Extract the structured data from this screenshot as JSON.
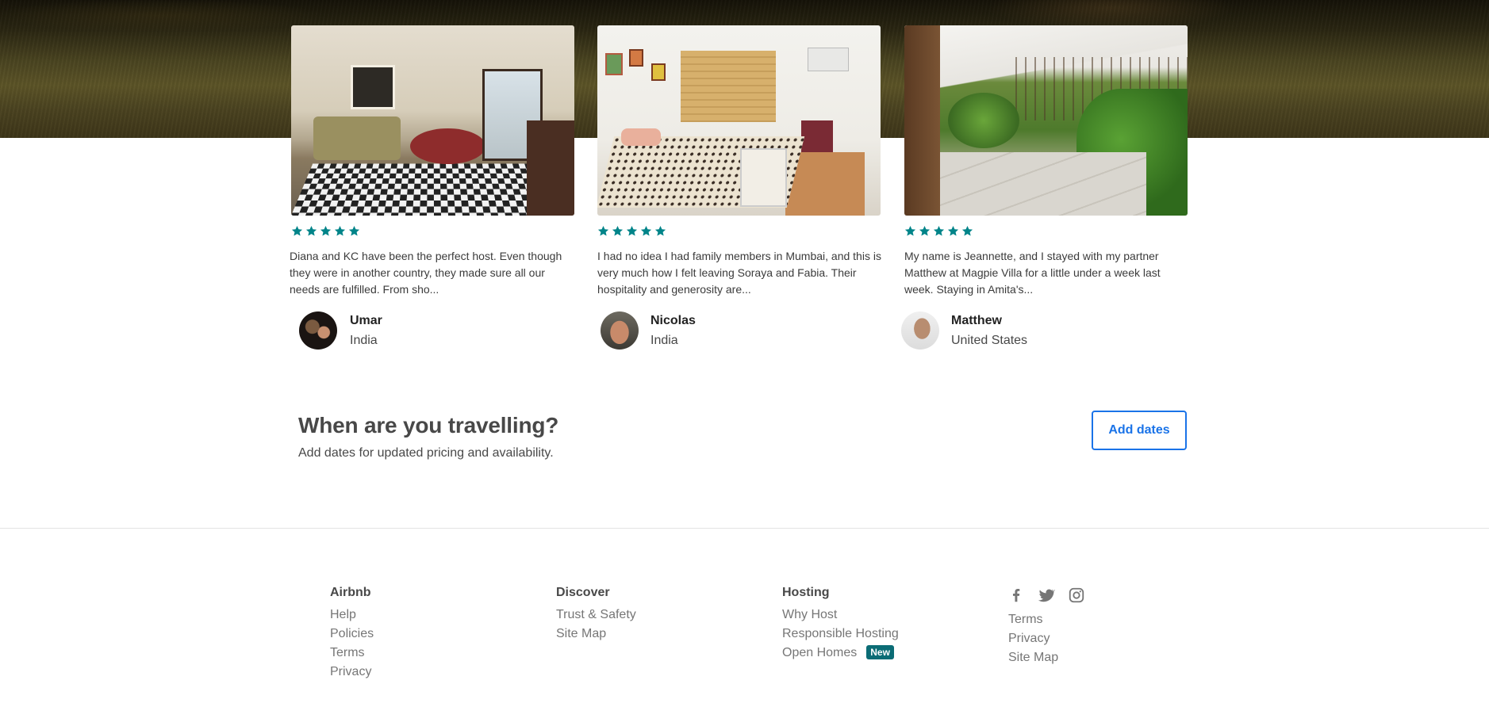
{
  "colors": {
    "star": "#008489",
    "link": "#1a73e8",
    "badge": "#0b6c75"
  },
  "reviews": [
    {
      "rating": 5,
      "text": "Diana and KC have been the perfect host. Even though they were in another country, they made sure all our needs are fulfilled. From sho...",
      "name": "Umar",
      "country": "India"
    },
    {
      "rating": 5,
      "text": "I had no idea I had family members in Mumbai, and this is very much how I felt leaving Soraya and Fabia. Their hospitality and generosity are...",
      "name": "Nicolas",
      "country": "India"
    },
    {
      "rating": 5,
      "text": "My name is Jeannette, and I stayed with my partner Matthew at Magpie Villa for a little under a week last week. Staying in Amita's...",
      "name": "Matthew",
      "country": "United States"
    }
  ],
  "travel": {
    "title": "When are you travelling?",
    "subtitle": "Add dates for updated pricing and availability.",
    "button": "Add dates"
  },
  "footer": {
    "airbnb": {
      "heading": "Airbnb",
      "links": [
        "Help",
        "Policies",
        "Terms",
        "Privacy"
      ]
    },
    "discover": {
      "heading": "Discover",
      "links": [
        "Trust & Safety",
        "Site Map"
      ]
    },
    "hosting": {
      "heading": "Hosting",
      "links": [
        "Why Host",
        "Responsible Hosting",
        "Open Homes"
      ],
      "badge": "New"
    },
    "social": [
      "facebook-icon",
      "twitter-icon",
      "instagram-icon"
    ],
    "legal": [
      "Terms",
      "Privacy",
      "Site Map"
    ]
  }
}
